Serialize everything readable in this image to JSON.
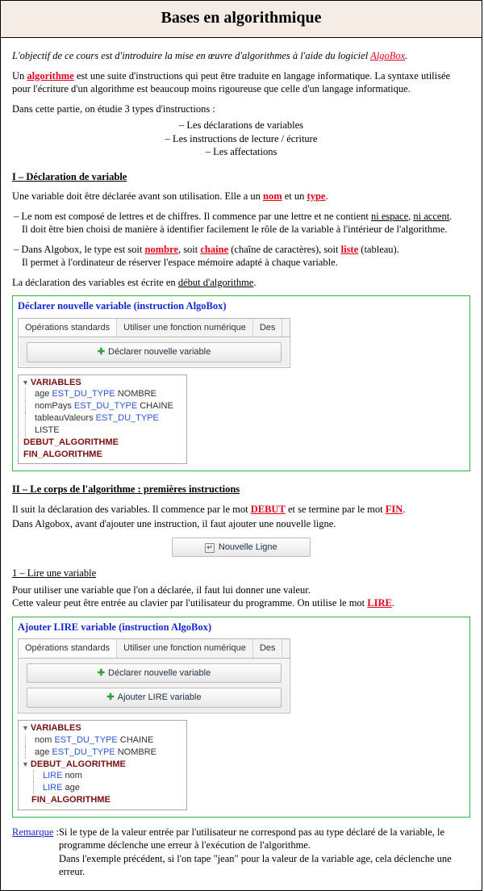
{
  "title": "Bases en algorithmique",
  "intro": {
    "obj_prefix": "L'objectif de ce cours est d'introduire la mise en œuvre d'algorithmes à l'aide du logiciel ",
    "algobox": "AlgoBox",
    "obj_suffix": ".",
    "p2a": "Un ",
    "p2_kw": "algorithme",
    "p2b": " est une suite d'instructions qui peut être traduite en langage informatique. La syntaxe utilisée pour l'écriture d'un algorithme est beaucoup moins rigoureuse que celle d'un langage informatique.",
    "p3": "Dans cette partie, on étudie 3 types d'instructions :",
    "b1": "– Les déclarations de variables",
    "b2": "– Les instructions de lecture / écriture",
    "b3": "– Les affectations"
  },
  "s1": {
    "head": "I – Déclaration de variable",
    "l1a": "Une variable doit être déclarée avant son utilisation. Elle a un ",
    "kw_nom": "nom",
    "l1b": " et un ",
    "kw_type": "type",
    "l1c": ".",
    "li1a": "– Le nom est composé de lettres et de chiffres. Il commence par une lettre et ne contient ",
    "ni_espace": "ni espace",
    "sep": ", ",
    "ni_accent": "ni accent",
    "dot": ".",
    "li1b": "Il doit être bien choisi de manière à identifier facilement le rôle de la variable à l'intérieur de l'algorithme.",
    "li2a": "– Dans Algobox, le type est soit ",
    "kw_nombre": "nombre",
    "soit1": ", soit ",
    "kw_chaine": "chaine",
    "paren1": " (chaîne de caractères), soit ",
    "kw_liste": "liste",
    "paren2": " (tableau).",
    "li2b": "Il permet à l'ordinateur de réserver l'espace mémoire adapté à chaque variable.",
    "l3a": "La déclaration des variables est écrite en ",
    "debut_algo": "début d'algorithme",
    "l3b": "."
  },
  "box1": {
    "title": "Déclarer nouvelle variable (instruction AlgoBox)",
    "tab1": "Opérations standards",
    "tab2": "Utiliser une fonction numérique",
    "tab3": "Des",
    "btn1": "Déclarer nouvelle variable",
    "tree": {
      "variables": "VARIABLES",
      "v1a": "age",
      "v1b": "EST_DU_TYPE",
      "v1c": "NOMBRE",
      "v2a": "nomPays",
      "v2b": "EST_DU_TYPE",
      "v2c": "CHAINE",
      "v3a": "tableauValeurs",
      "v3b": "EST_DU_TYPE",
      "v3c": "LISTE",
      "debut": "DEBUT_ALGORITHME",
      "fin": "FIN_ALGORITHME"
    }
  },
  "s2": {
    "head": "II – Le corps de l'algorithme : premières instructions",
    "p1a": "Il suit la déclaration des variables. Il commence par le mot ",
    "kw_debut": "DEBUT",
    "p1b": " et se termine par le mot ",
    "kw_fin": "FIN",
    "p1c": ".",
    "p2": "Dans Algobox, avant d'ajouter une instruction, il faut ajouter une nouvelle ligne.",
    "btn": "Nouvelle Ligne"
  },
  "s2_1": {
    "head": "1 – Lire une variable",
    "p1": "Pour utiliser une variable que l'on a déclarée, il faut lui donner une valeur.",
    "p2a": "Cette valeur peut être entrée au clavier par l'utilisateur du programme. On utilise le mot ",
    "kw_lire": "LIRE",
    "p2b": "."
  },
  "box2": {
    "title": "Ajouter LIRE variable (instruction AlgoBox)",
    "tab1": "Opérations standards",
    "tab2": "Utiliser une fonction numérique",
    "tab3": "Des",
    "btn1": "Déclarer nouvelle variable",
    "btn2": "Ajouter LIRE variable",
    "tree": {
      "variables": "VARIABLES",
      "v1a": "nom",
      "v1b": "EST_DU_TYPE",
      "v1c": "CHAINE",
      "v2a": "age",
      "v2b": "EST_DU_TYPE",
      "v2c": "NOMBRE",
      "debut": "DEBUT_ALGORITHME",
      "lire": "LIRE",
      "d1": "nom",
      "d2": "age",
      "fin": "FIN_ALGORITHME"
    }
  },
  "remarque": {
    "label": "Remarque",
    "sep": " : ",
    "p1": "Si le type de la valeur entrée par l'utilisateur ne correspond pas au type déclaré de la variable, le programme déclenche une erreur à l'exécution de l'algorithme.",
    "p2": "Dans l'exemple précédent, si l'on tape \"jean\" pour la valeur de la variable age, cela déclenche une erreur."
  }
}
